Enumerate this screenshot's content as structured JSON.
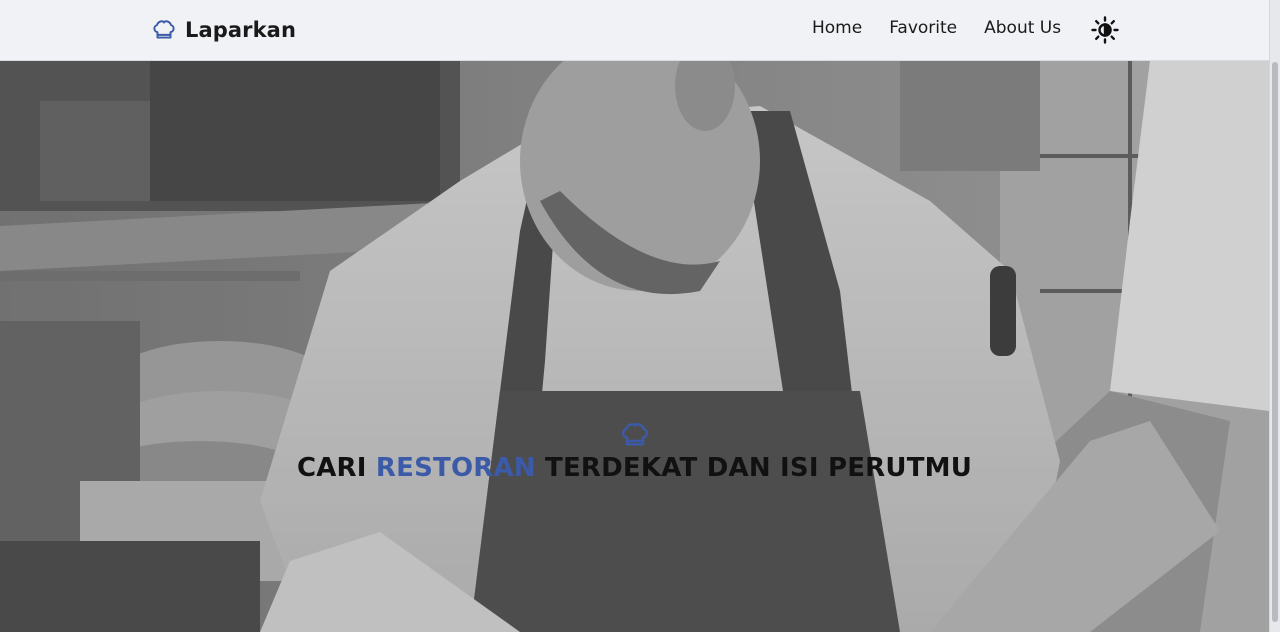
{
  "navbar": {
    "brand": "Laparkan",
    "brand_icon": "chef-hat-icon",
    "links": [
      {
        "label": "Home"
      },
      {
        "label": "Favorite"
      },
      {
        "label": "About Us"
      }
    ],
    "theme_toggle_icon": "sun-moon-icon"
  },
  "hero": {
    "icon": "chef-hat-icon",
    "title_before": "CARI ",
    "title_accent": "RESTORAN",
    "title_after": " TERDEKAT DAN ISI PERUTMU",
    "background": "chef-in-kitchen-grayscale-photo"
  },
  "colors": {
    "accent": "#3b5aa8",
    "navbar_bg": "#f1f2f6",
    "text": "#1a1a1a"
  }
}
